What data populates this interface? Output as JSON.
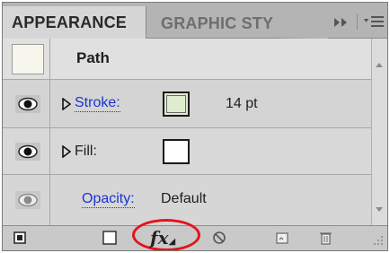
{
  "tabs": {
    "active": "APPEARANCE",
    "inactive": "GRAPHIC STY",
    "more_icon": "double-chevron-right-icon",
    "menu_icon": "panel-menu-icon"
  },
  "rows": {
    "path": {
      "label": "Path"
    },
    "stroke": {
      "label": "Stroke:",
      "value": "14 pt",
      "swatch_color": "#dfeccf"
    },
    "fill": {
      "label": "Fill:",
      "swatch_color": "#ffffff"
    },
    "opacity": {
      "label": "Opacity:",
      "value": "Default"
    }
  },
  "toolbar": {
    "items": [
      "add-new-stroke-icon",
      "add-new-fill-icon",
      "fx-icon",
      "clear-appearance-icon",
      "duplicate-item-icon",
      "delete-item-icon"
    ],
    "fx_label": "fx",
    "highlight_color": "#e4141b"
  },
  "colors": {
    "link": "#1a35d0",
    "panel": "#d6d6d6"
  }
}
